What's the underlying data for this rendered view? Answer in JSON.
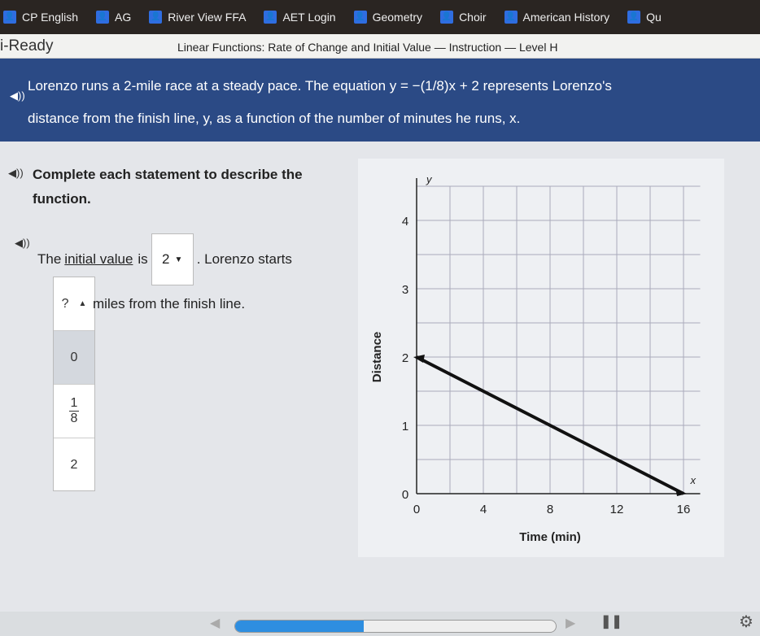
{
  "bookmarks": [
    {
      "label": "CP English",
      "icon": "person-icon"
    },
    {
      "label": "AG",
      "icon": "classroom-icon"
    },
    {
      "label": "River View FFA",
      "icon": "person-icon"
    },
    {
      "label": "AET Login",
      "icon": "aet-icon"
    },
    {
      "label": "Geometry",
      "icon": "classroom-icon"
    },
    {
      "label": "Choir",
      "icon": "classroom-icon"
    },
    {
      "label": "American History",
      "icon": "classroom-icon"
    },
    {
      "label": "Qu",
      "icon": "quizlet-icon"
    }
  ],
  "header": {
    "logo": "i-Ready",
    "lesson_title": "Linear Functions: Rate of Change and Initial Value — Instruction — Level H"
  },
  "problem": {
    "line1": "Lorenzo runs a 2-mile race at a steady pace. The equation y = −(1/8)x + 2 represents Lorenzo's",
    "line2": "distance from the finish line, y, as a function of the number of minutes he runs, x."
  },
  "task": {
    "instruction": "Complete each statement to describe the function.",
    "s_prefix": "The",
    "s_term": "initial value",
    "s_is": "is",
    "dropdown1_value": "2",
    ". Lorenzo starts": "",
    "s_suffix": ". Lorenzo starts",
    "dropdown2_value": "?",
    "dropdown2_options": [
      "0",
      "1/8",
      "2"
    ],
    "s2_suffix": "miles from the finish line."
  },
  "chart_data": {
    "type": "line",
    "xlabel": "Time (min)",
    "ylabel": "Distance",
    "x_axis_name": "x",
    "y_axis_name": "y",
    "x_ticks": [
      0,
      4,
      8,
      12,
      16
    ],
    "y_ticks": [
      0,
      1,
      2,
      3,
      4
    ],
    "xlim": [
      0,
      17
    ],
    "ylim": [
      0,
      4.5
    ],
    "grid": true,
    "series": [
      {
        "x": [
          0,
          16
        ],
        "y": [
          2,
          0
        ]
      }
    ]
  },
  "player": {
    "progress_percent": 40
  }
}
